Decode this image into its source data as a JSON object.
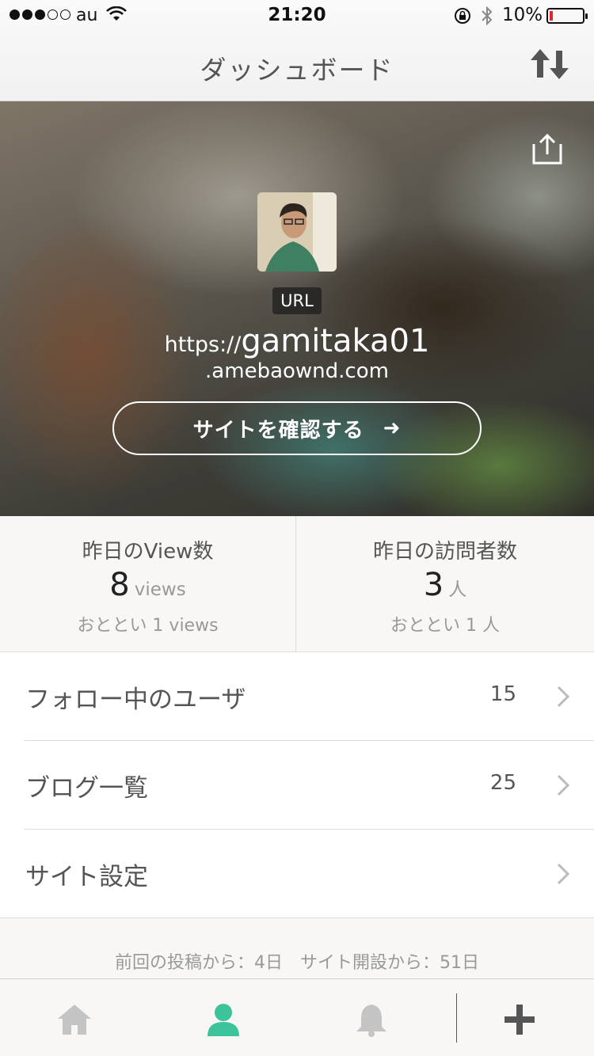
{
  "status_bar": {
    "carrier": "au",
    "time": "21:20",
    "battery": "10%",
    "battery_level": 0.1,
    "signal_bars_filled": 3,
    "signal_bars_total": 5
  },
  "nav": {
    "title": "ダッシュボード",
    "sort_icon": "sort-arrows-icon"
  },
  "hero": {
    "share_icon": "share-icon",
    "url_badge": "URL",
    "url_prefix": "https://",
    "url_subdomain": "gamitaka01",
    "url_domain": ".amebaownd.com",
    "visit_button": "サイトを確認する",
    "visit_arrow": "➜"
  },
  "stats": {
    "views": {
      "label": "昨日のView数",
      "value": "8",
      "unit": "views",
      "previous": "おととい 1 views"
    },
    "visitors": {
      "label": "昨日の訪問者数",
      "value": "3",
      "unit": "人",
      "previous": "おととい 1 人"
    }
  },
  "menu": {
    "items": [
      {
        "label": "フォロー中のユーザ",
        "count": "15"
      },
      {
        "label": "ブログ一覧",
        "count": "25"
      },
      {
        "label": "サイト設定",
        "count": ""
      }
    ]
  },
  "footer_info": "前回の投稿から：4日　サイト開設から：51日",
  "tabs": [
    {
      "icon": "home-icon",
      "active": false
    },
    {
      "icon": "user-icon",
      "active": true
    },
    {
      "icon": "bell-icon",
      "active": false
    },
    {
      "icon": "plus-icon",
      "active": false
    }
  ],
  "colors": {
    "accent": "#3cc39a",
    "tab_inactive": "#c4c4c4",
    "battery_low": "#e0262c"
  }
}
